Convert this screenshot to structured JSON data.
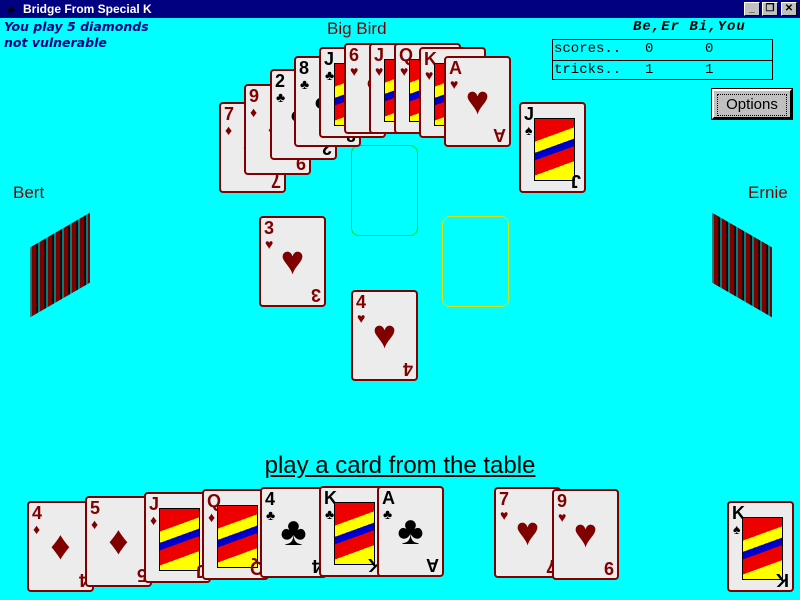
{
  "window": {
    "title": "Bridge From Special K",
    "minimize": "_",
    "restore": "❐",
    "close": "✕"
  },
  "contract": {
    "line1": "You play 5 diamonds",
    "line2": "not vulnerable"
  },
  "players": {
    "north": "Big Bird",
    "west": "Bert",
    "east": "Ernie"
  },
  "scoreboard": {
    "header": "Be,Er Bi,You",
    "rows": [
      {
        "label": "scores..",
        "a": "0",
        "b": "0"
      },
      {
        "label": "tricks..",
        "a": "1",
        "b": "1"
      }
    ]
  },
  "options_label": "Options",
  "prompt": "play a card from the table",
  "dummy": [
    {
      "rank": "7",
      "suit": "diamonds"
    },
    {
      "rank": "9",
      "suit": "diamonds"
    },
    {
      "rank": "2",
      "suit": "clubs"
    },
    {
      "rank": "8",
      "suit": "clubs"
    },
    {
      "rank": "J",
      "suit": "clubs"
    },
    {
      "rank": "6",
      "suit": "hearts"
    },
    {
      "rank": "J",
      "suit": "hearts"
    },
    {
      "rank": "Q",
      "suit": "hearts"
    },
    {
      "rank": "K",
      "suit": "hearts"
    },
    {
      "rank": "A",
      "suit": "hearts"
    },
    {
      "rank": "J",
      "suit": "spades"
    }
  ],
  "trick": [
    {
      "player": "west",
      "rank": "3",
      "suit": "hearts"
    },
    {
      "player": "south",
      "rank": "4",
      "suit": "hearts"
    }
  ],
  "hand": [
    {
      "rank": "4",
      "suit": "diamonds"
    },
    {
      "rank": "5",
      "suit": "diamonds"
    },
    {
      "rank": "J",
      "suit": "diamonds"
    },
    {
      "rank": "Q",
      "suit": "diamonds"
    },
    {
      "rank": "4",
      "suit": "clubs"
    },
    {
      "rank": "K",
      "suit": "clubs"
    },
    {
      "rank": "A",
      "suit": "clubs"
    },
    {
      "rank": "7",
      "suit": "hearts"
    },
    {
      "rank": "9",
      "suit": "hearts"
    },
    {
      "rank": "K",
      "suit": "spades"
    }
  ],
  "colors": {
    "table": "#00ffff",
    "card_border": "#800000",
    "north_slot": "#00e000",
    "east_slot": "#e0e000"
  }
}
